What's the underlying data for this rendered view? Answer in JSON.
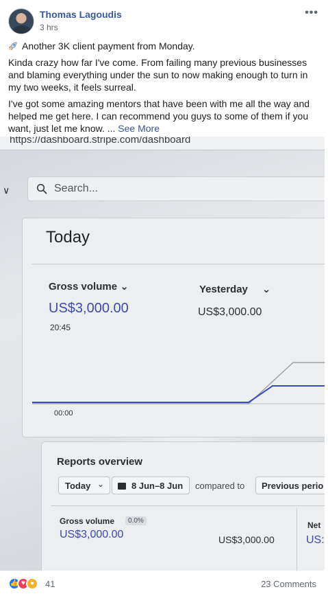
{
  "post": {
    "author": "Thomas Lagoudis",
    "timestamp": "3 hrs",
    "more_menu": "•••",
    "line1": "Another 3K client payment from Monday.",
    "paragraph2": "Kinda crazy how far I've come. From failing many previous businesses and blaming everything under the sun to now making enough to turn in my two weeks, it feels surreal.",
    "paragraph3": "I've got some amazing mentors that have been with me all the way and helped me get here. I can recommend you guys to some of them if you want, just let me know. ...",
    "see_more": "See More"
  },
  "photo": {
    "url": "https://dashboard.stripe.com/dashboard",
    "search_placeholder": "Search...",
    "today_card": {
      "title": "Today",
      "gross_volume_label": "Gross volume",
      "gross_volume_value": "US$3,000.00",
      "gross_volume_time": "20:45",
      "yesterday_label": "Yesterday",
      "yesterday_value": "US$3,000.00",
      "chart_tick": "00:00",
      "today_color": "#3b48c4",
      "yesterday_color": "#9aa0a8"
    },
    "reports_card": {
      "title": "Reports overview",
      "period": "Today",
      "date_range": "8 Jun–8 Jun",
      "compared_to": "compared to",
      "previous_period": "Previous perio",
      "gross_volume_label": "Gross volume",
      "gross_volume_badge": "0.0%",
      "gross_volume_value": "US$3,000.00",
      "previous_value": "US$3,000.00",
      "net_label": "Net",
      "net_value": "US:"
    }
  },
  "footer": {
    "reaction_count": "41",
    "comments": "23 Comments",
    "reaction_icons": [
      "like-icon",
      "love-icon",
      "wow-icon"
    ]
  }
}
